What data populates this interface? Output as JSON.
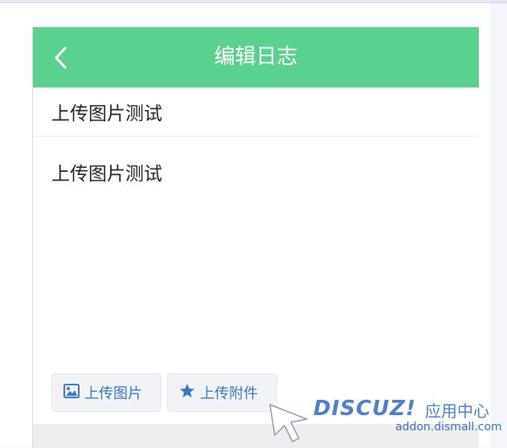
{
  "header": {
    "title": "编辑日志"
  },
  "editor": {
    "title_value": "上传图片测试",
    "content_value": "上传图片测试"
  },
  "toolbar": {
    "upload_image_label": "上传图片",
    "upload_attachment_label": "上传附件"
  },
  "watermark": {
    "logo_text": "DISCUZ!",
    "app_center_text": "应用中心",
    "url_text": "addon.dismall.com"
  },
  "colors": {
    "header_bg": "#5ad18f",
    "button_text": "#3a78c2",
    "watermark_blue": "#4b7fd1"
  },
  "icons": {
    "back": "chevron-left-icon",
    "image": "image-icon",
    "attachment": "star-icon",
    "cursor": "cursor-arrow-icon"
  }
}
